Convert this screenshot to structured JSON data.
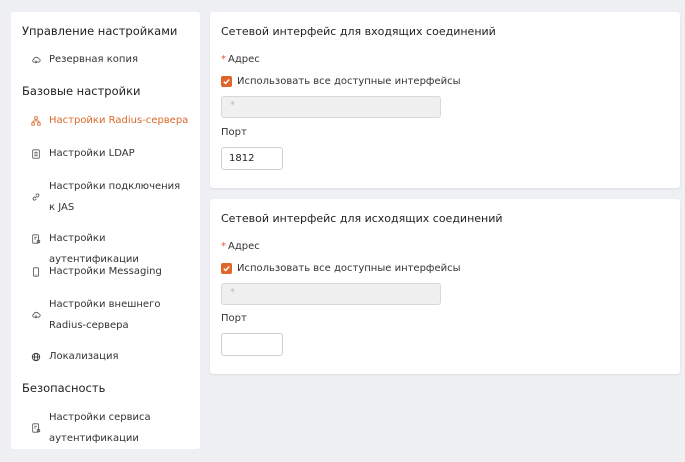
{
  "sidebar": {
    "sections": [
      {
        "label": "Управление настройками"
      },
      {
        "label": "Базовые настройки"
      },
      {
        "label": "Безопасность"
      }
    ],
    "items": [
      {
        "label": "Резервная копия",
        "icon": "cloud-sync-icon"
      },
      {
        "label": "Настройки Radius-сервера",
        "icon": "network-icon",
        "active": true
      },
      {
        "label": "Настройки LDAP",
        "icon": "document-icon"
      },
      {
        "label": "Настройки подключения к JAS",
        "icon": "link-icon"
      },
      {
        "label": "Настройки аутентификации",
        "icon": "auth-document-icon"
      },
      {
        "label": "Настройки Messaging",
        "icon": "phone-icon"
      },
      {
        "label": "Настройки внешнего Radius-сервера",
        "icon": "cloud-sync-icon"
      },
      {
        "label": "Локализация",
        "icon": "globe-icon"
      },
      {
        "label": "Настройки сервиса аутентификации",
        "icon": "auth-document-icon"
      }
    ]
  },
  "incoming": {
    "title": "Сетевой интерфейс для входящих соединений",
    "address_label": "Адрес",
    "required_mark": "*",
    "use_all_label": "Использовать все доступные интерфейсы",
    "use_all_checked": true,
    "address_value": "*",
    "port_label": "Порт",
    "port_value": "1812"
  },
  "outgoing": {
    "title": "Сетевой интерфейс для исходящих соединений",
    "address_label": "Адрес",
    "required_mark": "*",
    "use_all_label": "Использовать все доступные интерфейсы",
    "use_all_checked": true,
    "address_value": "*",
    "port_label": "Порт",
    "port_value": ""
  },
  "colors": {
    "accent": "#e0652d",
    "active_text": "#d9692a",
    "background": "#eef0f4"
  }
}
